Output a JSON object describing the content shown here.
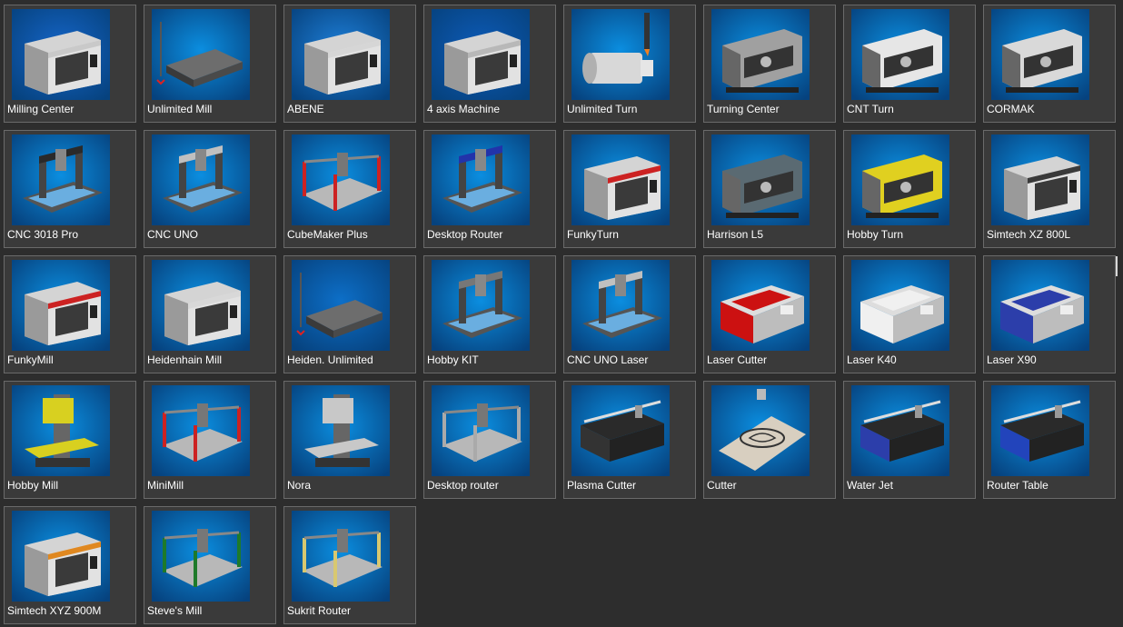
{
  "machines": [
    {
      "label": "Milling Center",
      "icon": "milling-center-icon",
      "kind": "enclosure",
      "bg": "#1565c8",
      "accent": "#c9c9c9"
    },
    {
      "label": "Unlimited Mill",
      "icon": "unlimited-mill-icon",
      "kind": "slab",
      "bg": "#0b8ee0",
      "accent": "#555555"
    },
    {
      "label": "ABENE",
      "icon": "abene-icon",
      "kind": "enclosure",
      "bg": "#1e7fd8",
      "accent": "#d6d6d6"
    },
    {
      "label": "4 axis Machine",
      "icon": "four-axis-machine-icon",
      "kind": "enclosure",
      "bg": "#0d5bb8",
      "accent": "#b8b8b8"
    },
    {
      "label": "Unlimited Turn",
      "icon": "unlimited-turn-icon",
      "kind": "cylinder",
      "bg": "#0b8ee0",
      "accent": "#d0d0d0"
    },
    {
      "label": "Turning Center",
      "icon": "turning-center-icon",
      "kind": "lathe",
      "bg": "#0b8ee0",
      "accent": "#a0a0a0"
    },
    {
      "label": "CNT Turn",
      "icon": "cnt-turn-icon",
      "kind": "lathe",
      "bg": "#0b8ee0",
      "accent": "#e6e6e6"
    },
    {
      "label": "CORMAK",
      "icon": "cormak-icon",
      "kind": "lathe",
      "bg": "#0b8ee0",
      "accent": "#d9d9d9"
    },
    {
      "label": "CNC 3018 Pro",
      "icon": "cnc-3018-pro-icon",
      "kind": "router",
      "bg": "#0b8ee0",
      "accent": "#2a2a2a"
    },
    {
      "label": "CNC UNO",
      "icon": "cnc-uno-icon",
      "kind": "router",
      "bg": "#0b8ee0",
      "accent": "#c0c0c0"
    },
    {
      "label": "CubeMaker Plus",
      "icon": "cubemaker-plus-icon",
      "kind": "frame",
      "bg": "#0b8ee0",
      "accent": "#cc2222"
    },
    {
      "label": "Desktop Router",
      "icon": "desktop-router-icon",
      "kind": "router",
      "bg": "#0b8ee0",
      "accent": "#2233aa"
    },
    {
      "label": "FunkyTurn",
      "icon": "funkyturn-icon",
      "kind": "enclosure",
      "bg": "#0b8ee0",
      "accent": "#cc2222"
    },
    {
      "label": "Harrison L5",
      "icon": "harrison-l5-icon",
      "kind": "lathe",
      "bg": "#0b8ee0",
      "accent": "#5a6a72"
    },
    {
      "label": "Hobby Turn",
      "icon": "hobby-turn-icon",
      "kind": "lathe",
      "bg": "#0b8ee0",
      "accent": "#e0d020"
    },
    {
      "label": "Simtech XZ 800L",
      "icon": "simtech-xz-800l-icon",
      "kind": "enclosure",
      "bg": "#0b8ee0",
      "accent": "#3a3a3a"
    },
    {
      "label": "FunkyMill",
      "icon": "funkymill-icon",
      "kind": "enclosure",
      "bg": "#0b8ee0",
      "accent": "#cc2222"
    },
    {
      "label": "Heidenhain Mill",
      "icon": "heidenhain-mill-icon",
      "kind": "enclosure",
      "bg": "#0b8ee0",
      "accent": "#d8d8d8"
    },
    {
      "label": "Heiden. Unlimited",
      "icon": "heiden-unlimited-icon",
      "kind": "slab",
      "bg": "#0d6fc8",
      "accent": "#555555"
    },
    {
      "label": "Hobby KIT",
      "icon": "hobby-kit-icon",
      "kind": "router",
      "bg": "#0b8ee0",
      "accent": "#777777"
    },
    {
      "label": "CNC UNO Laser",
      "icon": "cnc-uno-laser-icon",
      "kind": "router",
      "bg": "#0b8ee0",
      "accent": "#c0c0c0"
    },
    {
      "label": "Laser Cutter",
      "icon": "laser-cutter-icon",
      "kind": "box",
      "bg": "#0b8ee0",
      "accent": "#cc1111"
    },
    {
      "label": "Laser K40",
      "icon": "laser-k40-icon",
      "kind": "box",
      "bg": "#0b8ee0",
      "accent": "#f0f0f0"
    },
    {
      "label": "Laser X90",
      "icon": "laser-x90-icon",
      "kind": "box",
      "bg": "#0b8ee0",
      "accent": "#2c3eaa"
    },
    {
      "label": "Hobby Mill",
      "icon": "hobby-mill-icon",
      "kind": "column",
      "bg": "#0b8ee0",
      "accent": "#d8d020"
    },
    {
      "label": "MiniMill",
      "icon": "minimill-icon",
      "kind": "frame",
      "bg": "#0b8ee0",
      "accent": "#cc2222"
    },
    {
      "label": "Nora",
      "icon": "nora-icon",
      "kind": "column",
      "bg": "#0b8ee0",
      "accent": "#c8c8c8"
    },
    {
      "label": "Desktop router",
      "icon": "desktop-router-2-icon",
      "kind": "frame",
      "bg": "#0b8ee0",
      "accent": "#aaaaaa"
    },
    {
      "label": "Plasma Cutter",
      "icon": "plasma-cutter-icon",
      "kind": "table",
      "bg": "#0b8ee0",
      "accent": "#333333"
    },
    {
      "label": "Cutter",
      "icon": "cutter-icon",
      "kind": "plate",
      "bg": "#0b8ee0",
      "accent": "#d8cfc0"
    },
    {
      "label": "Water Jet",
      "icon": "water-jet-icon",
      "kind": "table",
      "bg": "#0b8ee0",
      "accent": "#2c3eaa"
    },
    {
      "label": "Router Table",
      "icon": "router-table-icon",
      "kind": "table",
      "bg": "#0b8ee0",
      "accent": "#2244bb"
    },
    {
      "label": "Simtech XYZ 900M",
      "icon": "simtech-xyz-900m-icon",
      "kind": "enclosure",
      "bg": "#0b8ee0",
      "accent": "#e08820"
    },
    {
      "label": "Steve's Mill",
      "icon": "steves-mill-icon",
      "kind": "frame",
      "bg": "#0b8ee0",
      "accent": "#1e7a2a"
    },
    {
      "label": "Sukrit Router",
      "icon": "sukrit-router-icon",
      "kind": "frame",
      "bg": "#0b8ee0",
      "accent": "#d8c870"
    }
  ]
}
